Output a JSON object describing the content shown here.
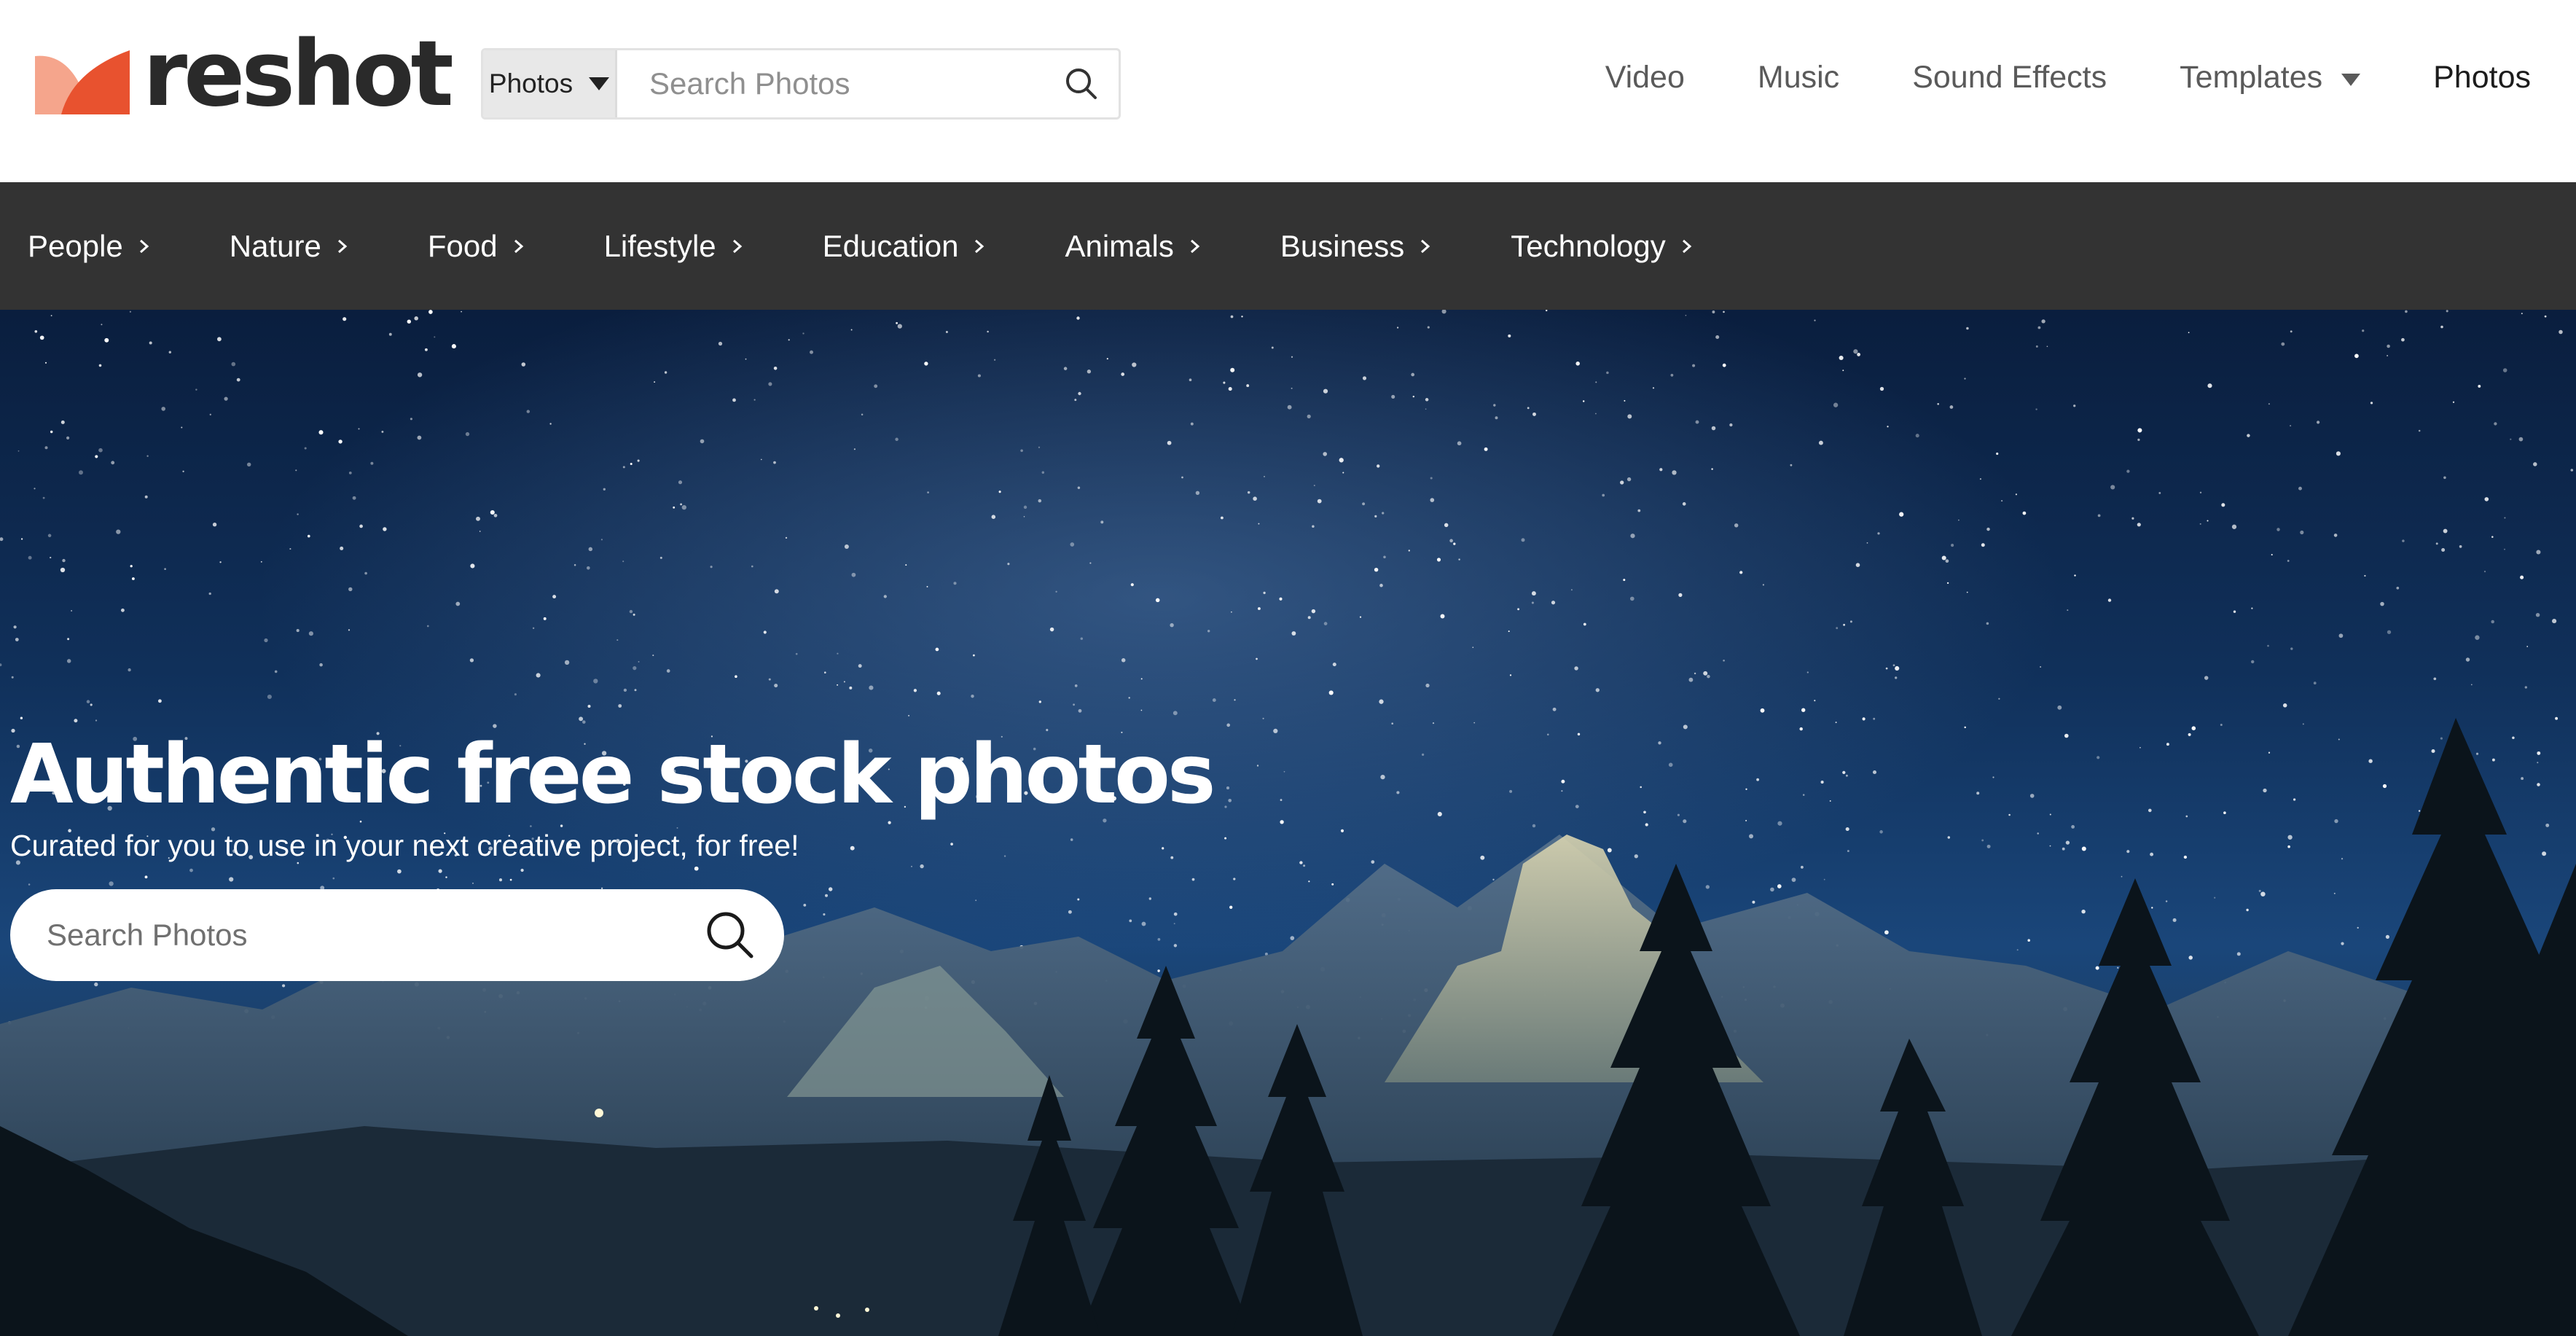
{
  "brand": {
    "name": "reshot",
    "colors": {
      "mark_light": "#f5a58c",
      "mark_dark": "#e8522f",
      "text": "#2a2a2a"
    }
  },
  "header_search": {
    "type_label": "Photos",
    "placeholder": "Search Photos",
    "icon": "search-icon"
  },
  "top_nav": {
    "items": [
      {
        "label": "Video"
      },
      {
        "label": "Music"
      },
      {
        "label": "Sound Effects"
      },
      {
        "label": "Templates",
        "has_dropdown": true
      },
      {
        "label": "Photos",
        "active": true
      }
    ]
  },
  "category_bar": {
    "background": "#333333",
    "items": [
      {
        "label": "People"
      },
      {
        "label": "Nature"
      },
      {
        "label": "Food"
      },
      {
        "label": "Lifestyle"
      },
      {
        "label": "Education"
      },
      {
        "label": "Animals"
      },
      {
        "label": "Business"
      },
      {
        "label": "Technology"
      }
    ]
  },
  "hero": {
    "title": "Authentic free stock photos",
    "subtitle": "Curated for you to use in your next creative project, for free!",
    "search_placeholder": "Search Photos",
    "background_image": "starry-night-mountains"
  }
}
